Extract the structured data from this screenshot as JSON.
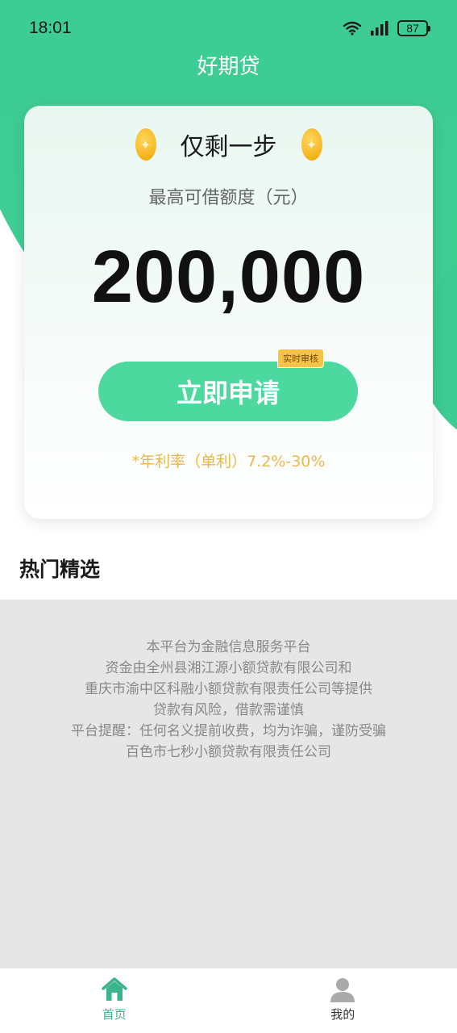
{
  "status_bar": {
    "time": "18:01",
    "battery": "87",
    "icons": [
      "wifi-icon",
      "signal-icon",
      "battery-icon"
    ]
  },
  "app_title": "好期贷",
  "card": {
    "step_text": "仅剩一步",
    "amount_label": "最高可借额度（元）",
    "amount": "200,000",
    "apply_button": "立即申请",
    "badge": "实时审核",
    "rate": "*年利率（单利）7.2%-30%"
  },
  "section_title": "热门精选",
  "disclaimer": {
    "lines": [
      "本平台为金融信息服务平台",
      "资金由全州县湘江源小额贷款有限公司和",
      "重庆市渝中区科融小额贷款有限责任公司等提供",
      "贷款有风险，借款需谨慎",
      "平台提醒：任何名义提前收费，均为诈骗，谨防受骗",
      "百色市七秒小额贷款有限责任公司"
    ]
  },
  "tabbar": {
    "home_label": "首页",
    "mine_label": "我的"
  },
  "colors": {
    "brand_green": "#3ccb92",
    "button_green": "#4dd8a0",
    "active_tab": "#3ab48a",
    "rate_gold": "#e8b84a"
  }
}
